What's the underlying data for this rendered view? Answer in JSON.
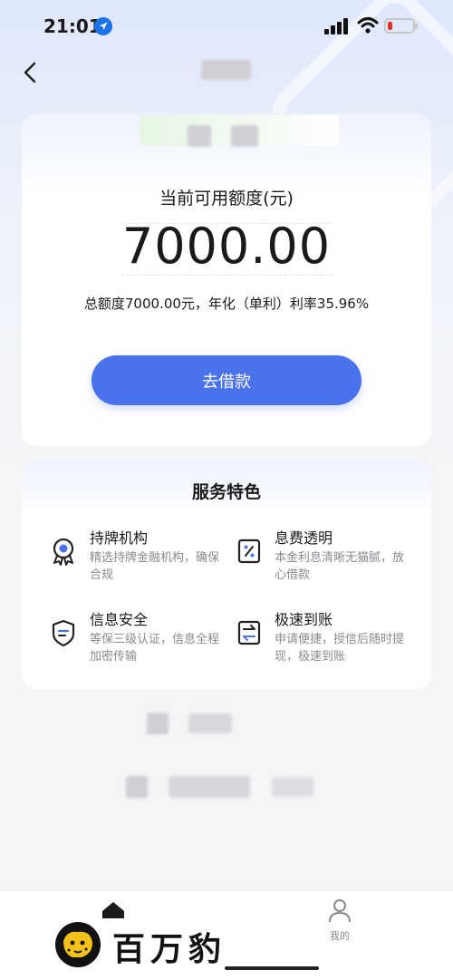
{
  "status_bar": {
    "time": "21:01"
  },
  "credit": {
    "label": "当前可用额度(元)",
    "amount": "7000.00",
    "summary": "总额度7000.00元，年化（单利）利率35.96%",
    "borrow_button": "去借款"
  },
  "services": {
    "title": "服务特色",
    "items": [
      {
        "icon": "licensed-medal-icon",
        "title": "持牌机构",
        "desc": "精选持牌金融机构，确保合规"
      },
      {
        "icon": "percent-doc-icon",
        "title": "息费透明",
        "desc": "本金利息清晰无猫腻，放心借款"
      },
      {
        "icon": "shield-icon",
        "title": "信息安全",
        "desc": "等保三级认证，信息全程加密传输"
      },
      {
        "icon": "transfer-icon",
        "title": "极速到账",
        "desc": "申请便捷，授信后随时提现，极速到账"
      }
    ]
  },
  "tabbar": {
    "mine_label": "我的"
  },
  "watermark": {
    "text": "百万豹"
  },
  "colors": {
    "primary": "#4a72ec",
    "background": "#f5f5f7"
  }
}
